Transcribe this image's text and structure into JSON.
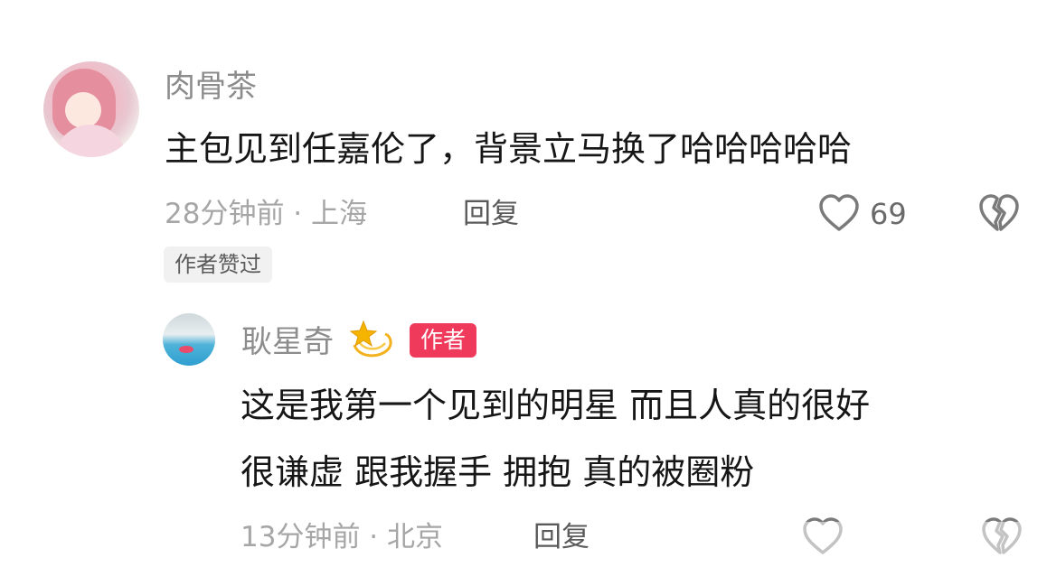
{
  "comment": {
    "username": "肉骨茶",
    "text": "主包见到任嘉伦了，背景立马换了哈哈哈哈哈",
    "time_location": "28分钟前 · 上海",
    "reply_label": "回复",
    "like_count": "69",
    "author_liked_badge": "作者赞过"
  },
  "reply": {
    "username": "耿星奇",
    "author_badge": "作者",
    "text_line1": "这是我第一个见到的明星 而且人真的很好",
    "text_line2": "很谦虚 跟我握手 拥抱 真的被圈粉",
    "time_location": "13分钟前 · 北京",
    "reply_label": "回复"
  },
  "icons": {
    "like": "heart-outline-icon",
    "dislike": "broken-heart-icon",
    "sparkle": "dizzy-star-emoji"
  },
  "colors": {
    "author_badge_bg": "#f03a5c",
    "username": "#8c8c8c",
    "meta": "#a6a6a6"
  }
}
